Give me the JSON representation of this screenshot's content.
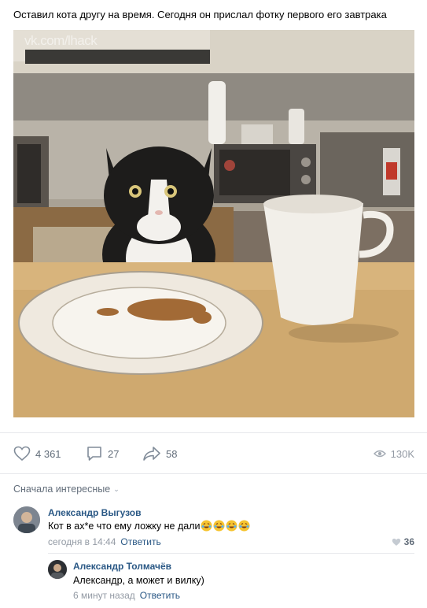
{
  "post": {
    "text": "Оставил кота другу на время. Сегодня он прислал фотку первого его завтрака",
    "watermark": "vk.com/lhack",
    "likes": "4 361",
    "comments": "27",
    "shares": "58",
    "views": "130K"
  },
  "comments_section": {
    "sort_label": "Сначала интересные",
    "items": [
      {
        "author": "Александр Выгузов",
        "text": "Кот в ах*е что ему ложку не дали",
        "emoji": [
          "rofl",
          "rofl",
          "rofl",
          "rofl"
        ],
        "time": "сегодня в 14:44",
        "reply_label": "Ответить",
        "likes": "36"
      },
      {
        "author": "Александр Толмачёв",
        "text": "Александр, а может и вилку)",
        "time": "6 минут назад",
        "reply_label": "Ответить"
      }
    ]
  },
  "icons": {
    "like": "heart-icon",
    "comment": "comment-icon",
    "share": "share-arrow-icon",
    "views": "eye-icon",
    "sort": "chevron-down-icon",
    "emoji": "rofl-emoji-icon"
  },
  "colors": {
    "link": "#2a5885",
    "secondary": "#626d7a",
    "muted": "#939aa4",
    "divider": "#e7e8ec"
  }
}
